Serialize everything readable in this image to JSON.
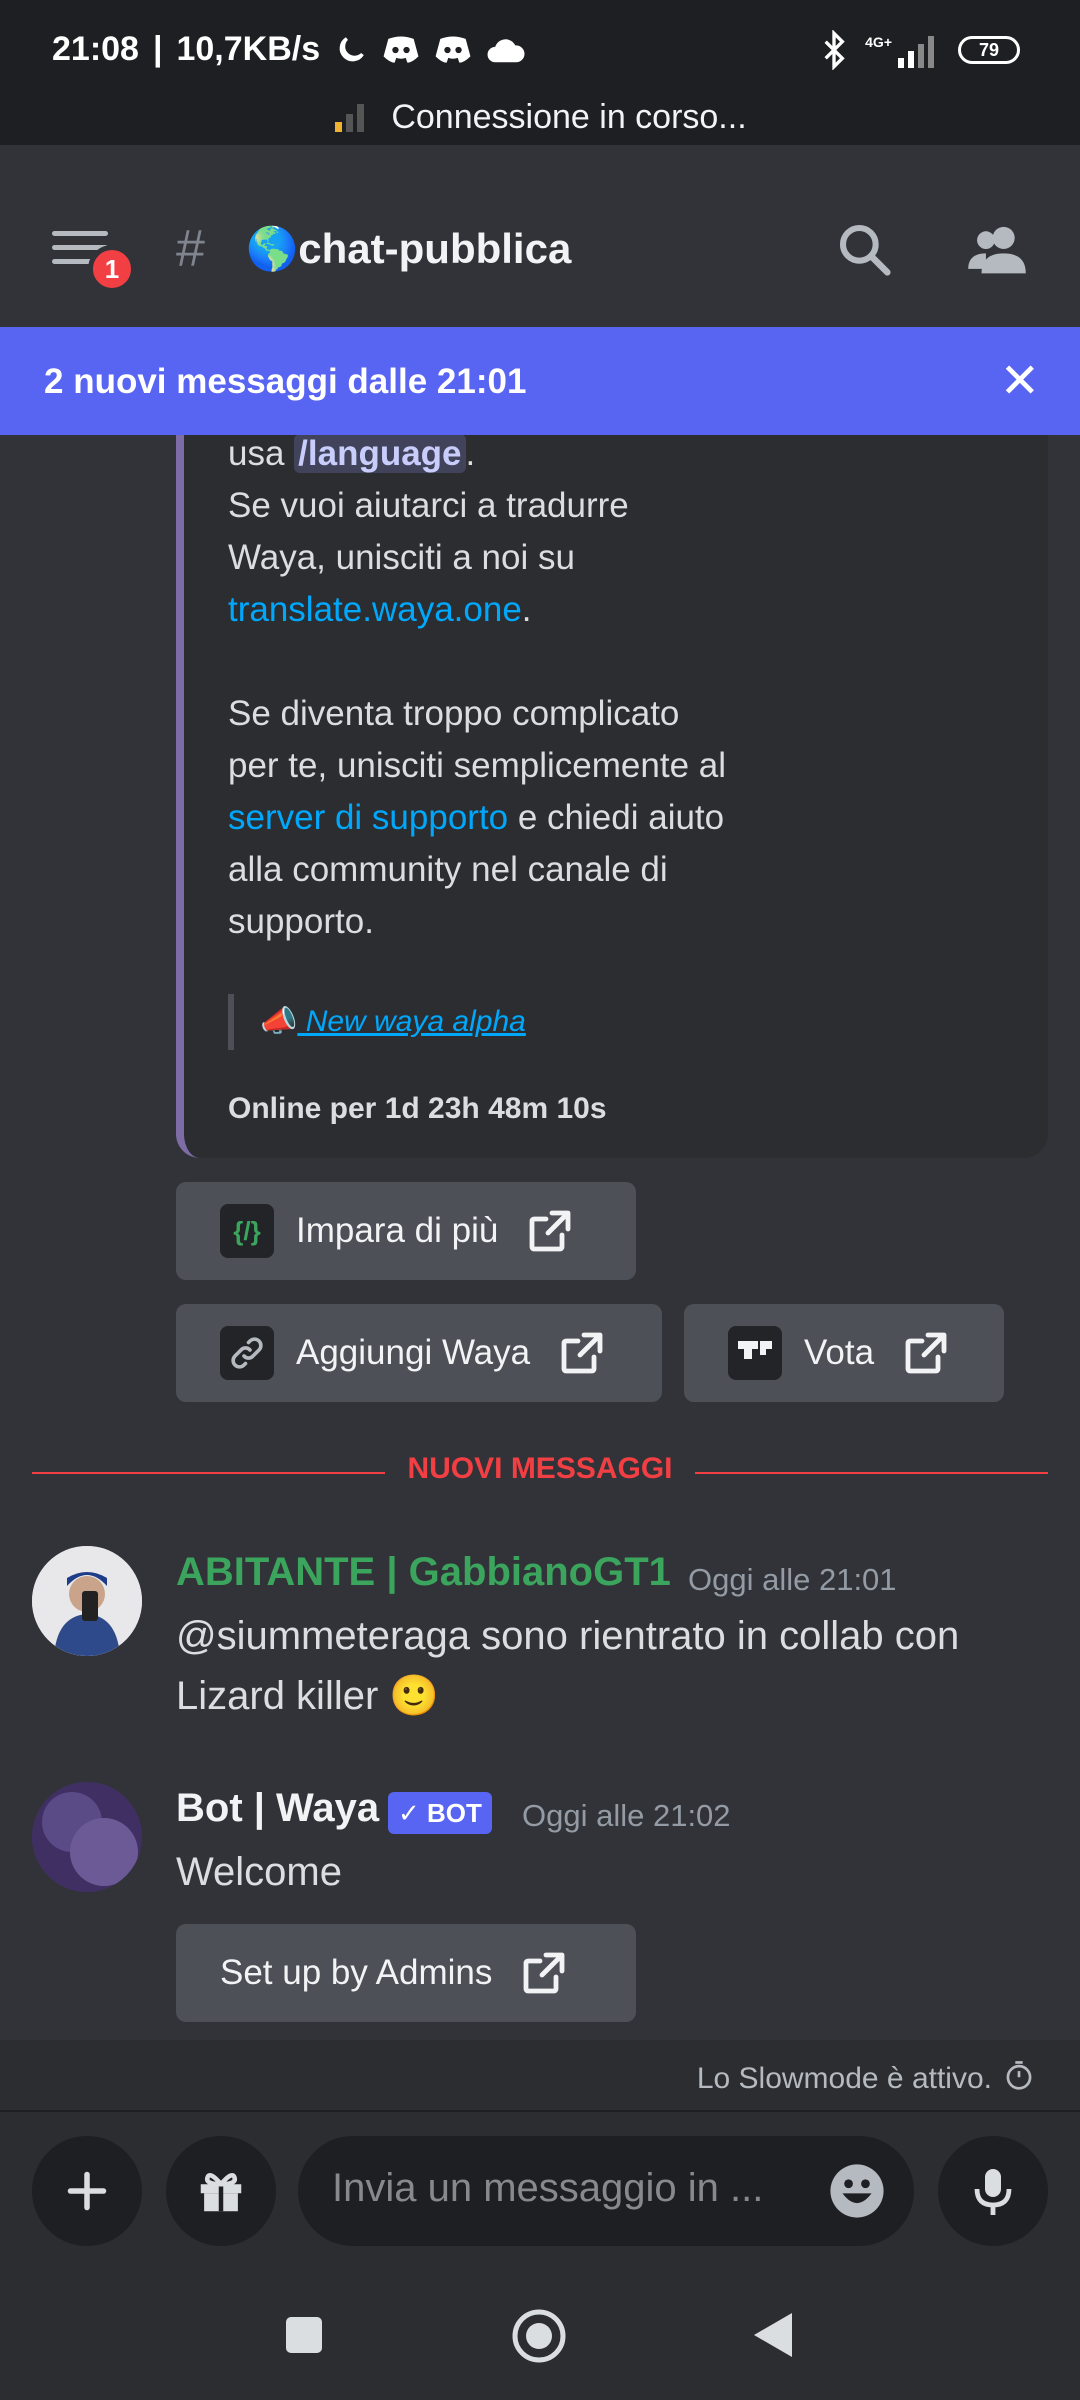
{
  "status": {
    "time": "21:08",
    "speed": "10,7KB/s",
    "network": "4G+",
    "battery": "79",
    "connecting": "Connessione in corso..."
  },
  "header": {
    "badge": "1",
    "hash": "#",
    "channel": "🌎chat-pubblica"
  },
  "new_messages_bar": {
    "text": "2 nuovi messaggi dalle 21:01",
    "close": "✕"
  },
  "embed": {
    "line_usa": "usa ",
    "code": "/language",
    "period1": ".",
    "translate_text": "Se vuoi aiutarci a tradurre Waya, unisciti a noi su ",
    "translate_link": "translate.waya.one",
    "period2": ".",
    "help_text": "Se diventa troppo complicato per te, unisciti semplicemente al ",
    "support_link": "server di supporto",
    "help_text2": " e chiedi aiuto alla community nel canale di supporto.",
    "quote_emoji": "📣",
    "quote_link": "New waya alpha",
    "footer": "Online per 1d 23h 48m 10s"
  },
  "buttons": {
    "learn_more": "Impara di più",
    "learn_icon": "{/}",
    "add_waya": "Aggiungi Waya",
    "vote": "Vota"
  },
  "divider": "NUOVI MESSAGGI",
  "messages": [
    {
      "author": "ABITANTE | GabbianoGT1",
      "time": "Oggi alle 21:01",
      "text": "@siummeteraga sono rientrato in collab con Lizard killer 🙂",
      "color": "#3ba55d"
    },
    {
      "author": "Bot | Waya",
      "badge": "✓ BOT",
      "time": "Oggi alle 21:02",
      "text": "Welcome",
      "button": "Set up by Admins"
    }
  ],
  "slowmode": "Lo Slowmode è attivo.",
  "input": {
    "placeholder": "Invia un messaggio in ..."
  },
  "colors": {
    "background": "#313338",
    "accent": "#5865f2",
    "link": "#00a8fc",
    "danger": "#f23f43"
  }
}
